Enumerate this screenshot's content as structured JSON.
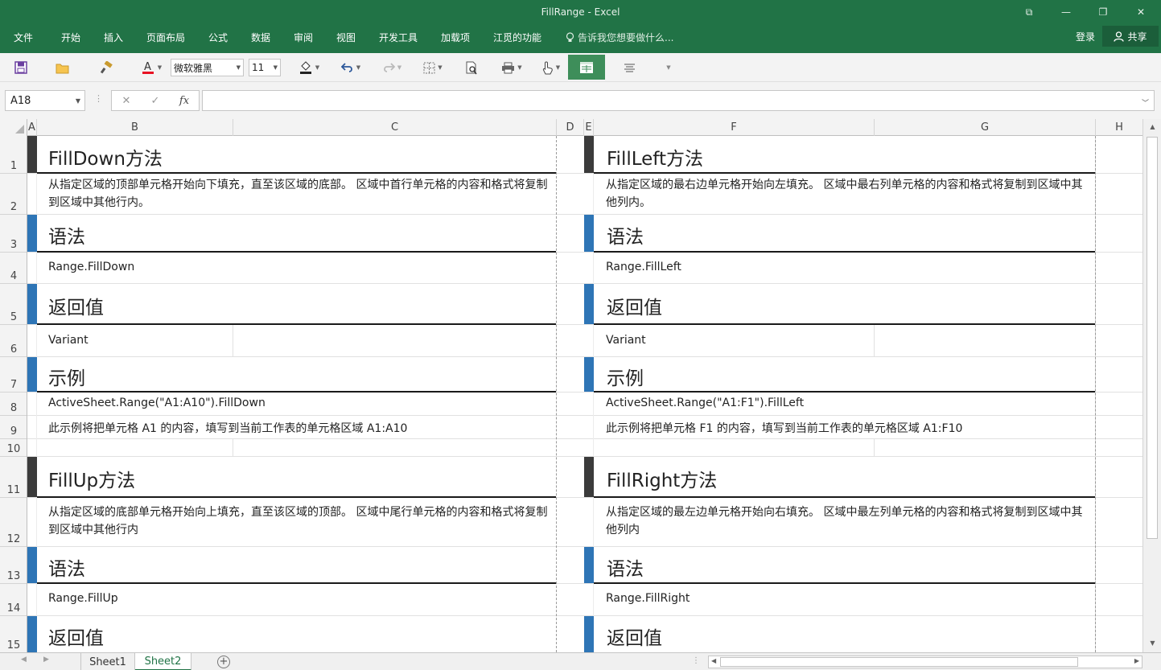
{
  "window": {
    "title": "FillRange - Excel",
    "controls": [
      "⧉",
      "—",
      "❐",
      "✕"
    ]
  },
  "ribbon": {
    "tabs": [
      "文件",
      "开始",
      "插入",
      "页面布局",
      "公式",
      "数据",
      "审阅",
      "视图",
      "开发工具",
      "加载项",
      "江觅的功能"
    ],
    "tell_me": "告诉我您想要做什么...",
    "login": "登录",
    "share": "共享"
  },
  "toolbar": {
    "font_name": "微软雅黑",
    "font_size": "11",
    "font_color": "#e81123"
  },
  "formula_bar": {
    "name_box": "A18",
    "cancel": "✕",
    "enter": "✓",
    "fx": "fx",
    "formula": ""
  },
  "columns": [
    "A",
    "B",
    "C",
    "D",
    "E",
    "F",
    "G",
    "H"
  ],
  "rows": [
    "1",
    "2",
    "3",
    "4",
    "5",
    "6",
    "7",
    "8",
    "9",
    "10",
    "11",
    "12",
    "13",
    "14",
    "15"
  ],
  "left_block": {
    "title1": "FillDown方法",
    "desc1": "从指定区域的顶部单元格开始向下填充，直至该区域的底部。 区域中首行单元格的内容和格式将复制到区域中其他行内。",
    "syntax_h": "语法",
    "syntax": "Range.FillDown",
    "return_h": "返回值",
    "return": "Variant",
    "example_h": "示例",
    "example_code": "ActiveSheet.Range(\"A1:A10\").FillDown",
    "example_desc": "此示例将把单元格 A1 的内容，填写到当前工作表的单元格区域 A1:A10",
    "title2": "FillUp方法",
    "desc2": "从指定区域的底部单元格开始向上填充，直至该区域的顶部。 区域中尾行单元格的内容和格式将复制到区域中其他行内",
    "syntax2_h": "语法",
    "syntax2": "Range.FillUp",
    "return2_h": "返回值"
  },
  "right_block": {
    "title1": "FillLeft方法",
    "desc1": "从指定区域的最右边单元格开始向左填充。 区域中最右列单元格的内容和格式将复制到区域中其他列内。",
    "syntax_h": "语法",
    "syntax": "Range.FillLeft",
    "return_h": "返回值",
    "return": "Variant",
    "example_h": "示例",
    "example_code": "ActiveSheet.Range(\"A1:F1\").FillLeft",
    "example_desc": "此示例将把单元格 F1 的内容，填写到当前工作表的单元格区域 A1:F10",
    "title2": "FillRight方法",
    "desc2": "从指定区域的最左边单元格开始向右填充。 区域中最左列单元格的内容和格式将复制到区域中其他列内",
    "syntax2_h": "语法",
    "syntax2": "Range.FillRight",
    "return2_h": "返回值"
  },
  "sheets": [
    "Sheet1",
    "Sheet2"
  ],
  "active_sheet": "Sheet2",
  "colors": {
    "brand": "#217346",
    "heading_bar_dark": "#3b3b3b",
    "heading_bar_blue": "#2e75b6"
  }
}
